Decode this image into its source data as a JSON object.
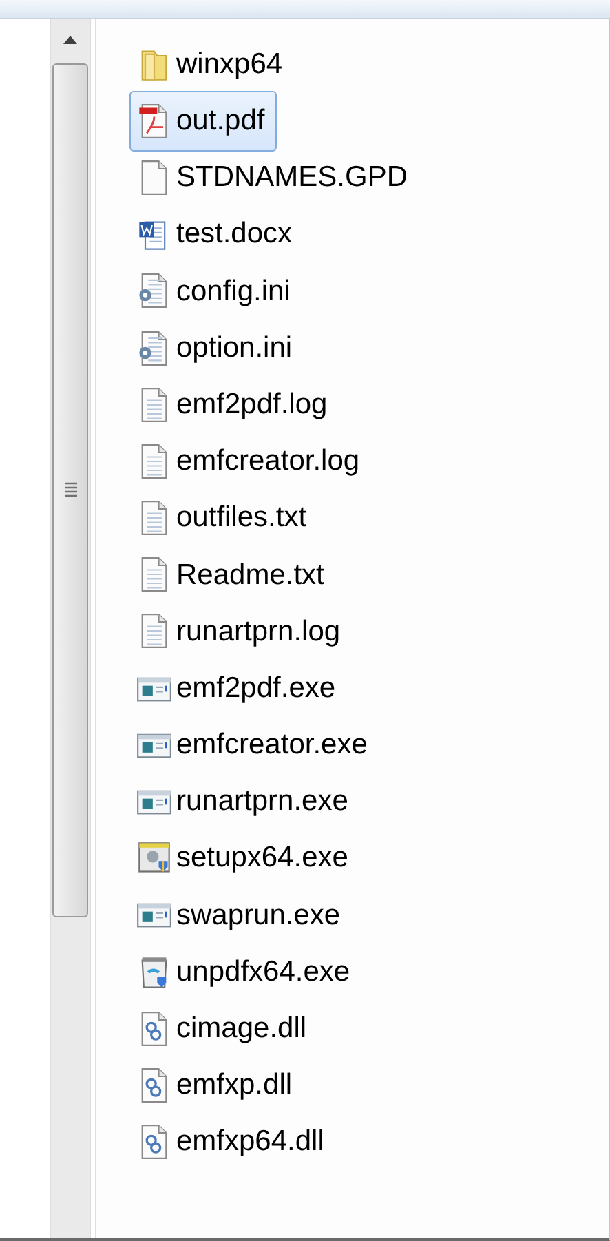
{
  "files": [
    {
      "name": "winxp64",
      "kind": "folder",
      "selected": false
    },
    {
      "name": "out.pdf",
      "kind": "pdf",
      "selected": true
    },
    {
      "name": "STDNAMES.GPD",
      "kind": "blank",
      "selected": false
    },
    {
      "name": "test.docx",
      "kind": "word",
      "selected": false
    },
    {
      "name": "config.ini",
      "kind": "settings",
      "selected": false
    },
    {
      "name": "option.ini",
      "kind": "settings",
      "selected": false
    },
    {
      "name": "emf2pdf.log",
      "kind": "text",
      "selected": false
    },
    {
      "name": "emfcreator.log",
      "kind": "text",
      "selected": false
    },
    {
      "name": "outfiles.txt",
      "kind": "text",
      "selected": false
    },
    {
      "name": "Readme.txt",
      "kind": "text",
      "selected": false
    },
    {
      "name": "runartprn.log",
      "kind": "text",
      "selected": false
    },
    {
      "name": "emf2pdf.exe",
      "kind": "exe",
      "selected": false
    },
    {
      "name": "emfcreator.exe",
      "kind": "exe",
      "selected": false
    },
    {
      "name": "runartprn.exe",
      "kind": "exe",
      "selected": false
    },
    {
      "name": "setupx64.exe",
      "kind": "installer",
      "selected": false
    },
    {
      "name": "swaprun.exe",
      "kind": "exe",
      "selected": false
    },
    {
      "name": "unpdfx64.exe",
      "kind": "uninstaller",
      "selected": false
    },
    {
      "name": "cimage.dll",
      "kind": "dll",
      "selected": false
    },
    {
      "name": "emfxp.dll",
      "kind": "dll",
      "selected": false
    },
    {
      "name": "emfxp64.dll",
      "kind": "dll",
      "selected": false
    }
  ]
}
